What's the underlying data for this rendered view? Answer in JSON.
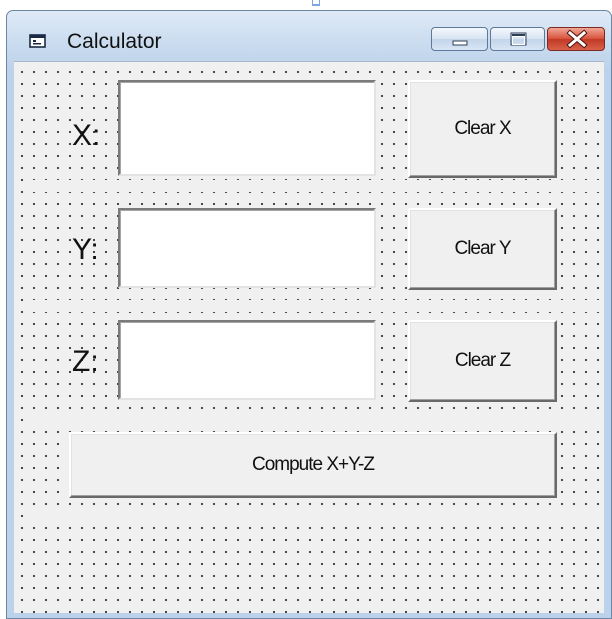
{
  "window": {
    "title": "Calculator",
    "icon": "form-icon"
  },
  "title_buttons": {
    "minimize_icon": "minimize-icon",
    "maximize_icon": "maximize-icon",
    "close_icon": "close-icon"
  },
  "form": {
    "x_label": "X:",
    "y_label": "Y:",
    "z_label": "Z:",
    "x_value": "",
    "y_value": "",
    "z_value": "",
    "clear_x_label": "Clear X",
    "clear_y_label": "Clear Y",
    "clear_z_label": "Clear Z",
    "compute_label": "Compute X+Y-Z"
  },
  "colors": {
    "title_bar": "#c9dbef",
    "client_background": "#f0f0f0",
    "grid_dots": "#2a2a2a",
    "close_button": "#c13a26"
  }
}
